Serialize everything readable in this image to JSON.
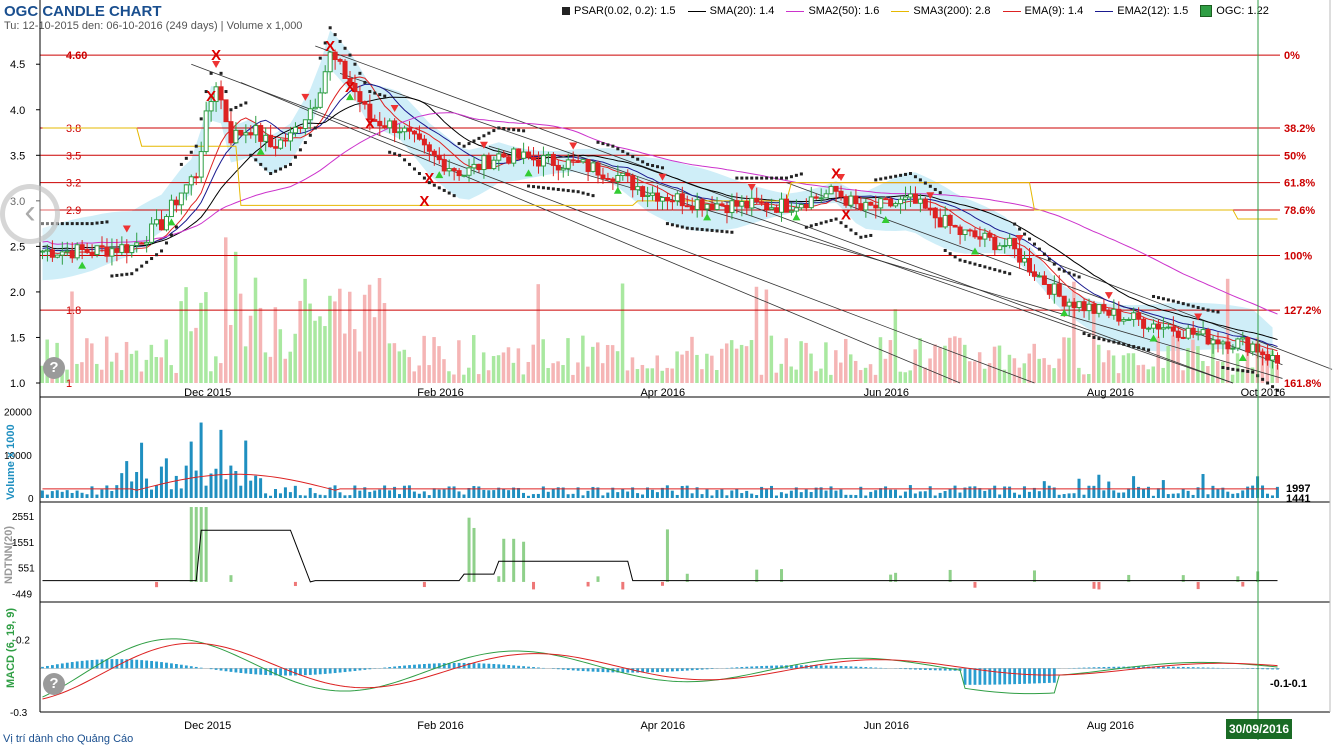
{
  "header": {
    "title": "OGC CANDLE CHART",
    "subtitle": "Tu: 12-10-2015 den: 06-10-2016 (249 days) | Volume x 1,000"
  },
  "legend": [
    {
      "label": "PSAR(0.02, 0.2): 1.5",
      "color": "#222222",
      "kind": "square"
    },
    {
      "label": "SMA(20): 1.4",
      "color": "#000000",
      "kind": "line"
    },
    {
      "label": "SMA2(50): 1.6",
      "color": "#cc33cc",
      "kind": "line"
    },
    {
      "label": "SMA3(200): 2.8",
      "color": "#e6b800",
      "kind": "line"
    },
    {
      "label": "EMA(9): 1.4",
      "color": "#dd2222",
      "kind": "line"
    },
    {
      "label": "EMA2(12): 1.5",
      "color": "#1a1a8f",
      "kind": "line"
    },
    {
      "label": "OGC: 1.22",
      "color": "#2f9e44",
      "kind": "box"
    }
  ],
  "footer": {
    "ad_link": "Vị trí dành cho Quảng Cáo",
    "cursor_date": "30/09/2016"
  },
  "colors": {
    "up": "#2f9e44",
    "down": "#dd2222",
    "cloud": "#bfe8f5",
    "fib": "#cc0000",
    "volume": "#1f8fc0"
  },
  "chart_data": [
    {
      "type": "candlestick",
      "panel": "price",
      "ylim": [
        1.0,
        4.7
      ],
      "y_ticks": [
        "1.0",
        "1.5",
        "2.0",
        "2.5",
        "3.0",
        "3.5",
        "4.0",
        "4.5"
      ],
      "x_ticks": [
        "Dec 2015",
        "Feb 2016",
        "Apr 2016",
        "Jun 2016",
        "Aug 2016",
        "Oct 2016"
      ],
      "price_marks": [
        {
          "label": "4.60",
          "value": 4.6
        },
        {
          "label": "3.8",
          "value": 3.8
        },
        {
          "label": "3.5",
          "value": 3.5
        },
        {
          "label": "3.2",
          "value": 3.2
        },
        {
          "label": "2.9",
          "value": 2.9
        },
        {
          "label": "1.8",
          "value": 1.8
        },
        {
          "label": "1",
          "value": 1.0
        }
      ],
      "fib_levels": [
        {
          "label": "0%",
          "value": 4.6
        },
        {
          "label": "38.2%",
          "value": 3.8
        },
        {
          "label": "50%",
          "value": 3.5
        },
        {
          "label": "61.8%",
          "value": 3.2
        },
        {
          "label": "78.6%",
          "value": 2.9
        },
        {
          "label": "100%",
          "value": 2.4
        },
        {
          "label": "127.2%",
          "value": 1.8
        },
        {
          "label": "161.8%",
          "value": 1.0
        }
      ],
      "close_path": [
        [
          0,
          2.45
        ],
        [
          10,
          2.45
        ],
        [
          18,
          2.5
        ],
        [
          24,
          2.75
        ],
        [
          28,
          3.1
        ],
        [
          31,
          3.3
        ],
        [
          33,
          3.9
        ],
        [
          35,
          4.3
        ],
        [
          38,
          3.7
        ],
        [
          42,
          3.8
        ],
        [
          46,
          3.6
        ],
        [
          50,
          3.7
        ],
        [
          55,
          4.1
        ],
        [
          58,
          4.6
        ],
        [
          62,
          4.3
        ],
        [
          66,
          3.9
        ],
        [
          72,
          3.8
        ],
        [
          78,
          3.5
        ],
        [
          85,
          3.3
        ],
        [
          92,
          3.5
        ],
        [
          100,
          3.45
        ],
        [
          108,
          3.4
        ],
        [
          115,
          3.3
        ],
        [
          122,
          3.1
        ],
        [
          130,
          3.0
        ],
        [
          140,
          2.95
        ],
        [
          150,
          2.95
        ],
        [
          160,
          3.1
        ],
        [
          165,
          2.9
        ],
        [
          175,
          3.0
        ],
        [
          185,
          2.65
        ],
        [
          195,
          2.5
        ],
        [
          205,
          1.95
        ],
        [
          212,
          1.8
        ],
        [
          220,
          1.7
        ],
        [
          228,
          1.6
        ],
        [
          235,
          1.5
        ],
        [
          240,
          1.45
        ],
        [
          244,
          1.42
        ],
        [
          249,
          1.22
        ]
      ]
    },
    {
      "type": "bar",
      "panel": "volume",
      "ylabel": "Volume x 1000",
      "ylim": [
        0,
        22000
      ],
      "y_ticks": [
        "0",
        "10000",
        "20000"
      ],
      "last_labels": [
        "1997",
        "1441"
      ]
    },
    {
      "type": "bar",
      "panel": "indicator",
      "ylabel": "NDTNN(20)",
      "ylim": [
        -700,
        2900
      ],
      "y_ticks": [
        "2551",
        "1551",
        "551",
        "-449"
      ]
    },
    {
      "type": "line",
      "panel": "macd",
      "ylabel": "MACD (6, 19, 9)",
      "ylim": [
        -0.3,
        0.45
      ],
      "y_ticks": [
        "0.2",
        "-0.3"
      ],
      "last_labels": [
        "-0.1",
        "-0.1"
      ]
    }
  ]
}
